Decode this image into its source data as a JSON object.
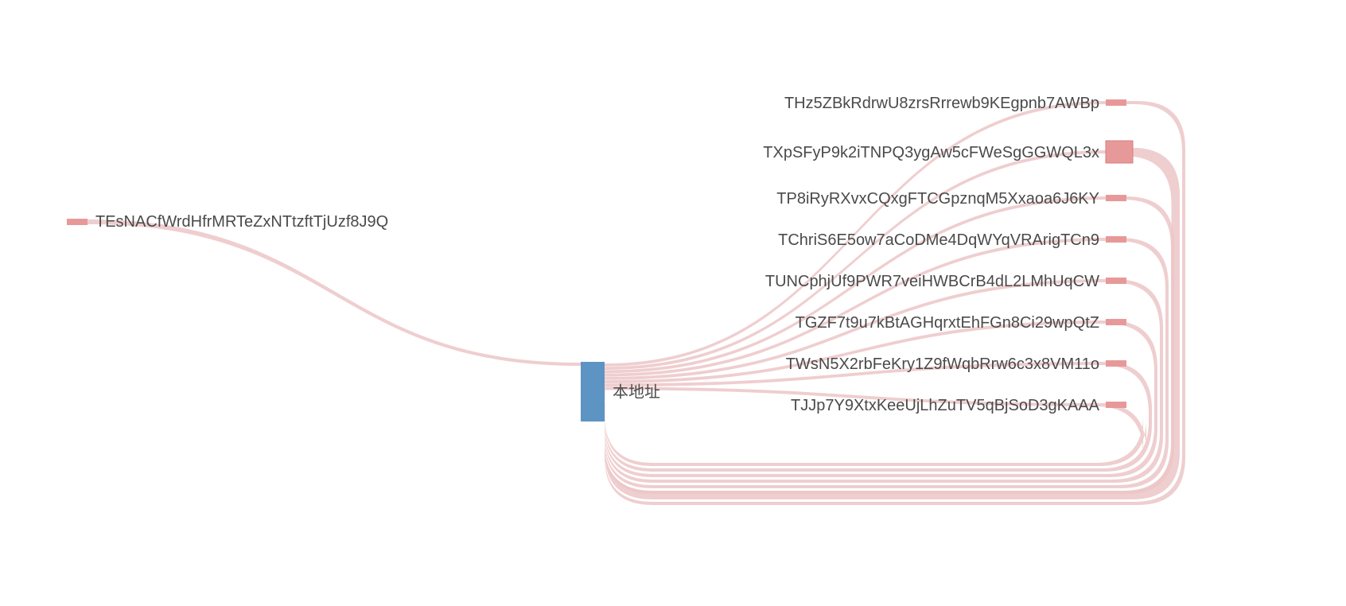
{
  "chart_data": {
    "type": "sankey",
    "center_node": {
      "id": "center",
      "label": "本地址",
      "color": "#5d94c4"
    },
    "left_nodes": [
      {
        "id": "L0",
        "label": "TEsNACfWrdHfrMRTeZxNTtzftTjUzf8J9Q",
        "weight": 1
      }
    ],
    "right_nodes": [
      {
        "id": "R0",
        "label": "THz5ZBkRdrwU8zrsRrrewb9KEgpnb7AWBp",
        "weight": 1
      },
      {
        "id": "R1",
        "label": "TXpSFyP9k2iTNPQ3ygAw5cFWeSgGGWQL3x",
        "weight": 3
      },
      {
        "id": "R2",
        "label": "TP8iRyRXvxCQxgFTCGpznqM5Xxaoa6J6KY",
        "weight": 1
      },
      {
        "id": "R3",
        "label": "TChriS6E5ow7aCoDMe4DqWYqVRArigTCn9",
        "weight": 1
      },
      {
        "id": "R4",
        "label": "TUNCphjUf9PWR7veiHWBCrB4dL2LMhUqCW",
        "weight": 1
      },
      {
        "id": "R5",
        "label": "TGZF7t9u7kBtAGHqrxtEhFGn8Ci29wpQtZ",
        "weight": 1
      },
      {
        "id": "R6",
        "label": "TWsN5X2rbFeKry1Z9fWqbRrw6c3x8VM11o",
        "weight": 1
      },
      {
        "id": "R7",
        "label": "TJJp7Y9XtxKeeUjLhZuTV5qBjSoD3gKAAA",
        "weight": 1
      }
    ],
    "flows_left_to_center": [
      {
        "from": "L0",
        "to": "center",
        "weight": 1
      }
    ],
    "flows_center_to_right": [
      {
        "from": "center",
        "to": "R0",
        "weight": 1
      },
      {
        "from": "center",
        "to": "R1",
        "weight": 1
      },
      {
        "from": "center",
        "to": "R2",
        "weight": 1
      },
      {
        "from": "center",
        "to": "R3",
        "weight": 1
      },
      {
        "from": "center",
        "to": "R4",
        "weight": 1
      },
      {
        "from": "center",
        "to": "R5",
        "weight": 1
      },
      {
        "from": "center",
        "to": "R6",
        "weight": 1
      },
      {
        "from": "center",
        "to": "R7",
        "weight": 1
      }
    ],
    "flows_right_to_center": [
      {
        "from": "R0",
        "to": "center",
        "weight": 1
      },
      {
        "from": "R1",
        "to": "center",
        "weight": 3
      },
      {
        "from": "R2",
        "to": "center",
        "weight": 1
      },
      {
        "from": "R3",
        "to": "center",
        "weight": 1
      },
      {
        "from": "R4",
        "to": "center",
        "weight": 1
      },
      {
        "from": "R5",
        "to": "center",
        "weight": 1
      },
      {
        "from": "R6",
        "to": "center",
        "weight": 1
      },
      {
        "from": "R7",
        "to": "center",
        "weight": 1
      }
    ],
    "colors": {
      "link": "#ecc6c7",
      "node_right": "#e79999",
      "node_center": "#5d94c4",
      "text": "#4a4a4a"
    }
  }
}
